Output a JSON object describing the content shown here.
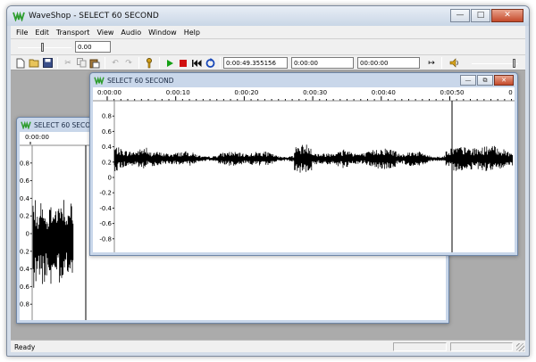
{
  "app": {
    "title": "WaveShop - SELECT 60 SECOND"
  },
  "menu": [
    "File",
    "Edit",
    "Transport",
    "View",
    "Audio",
    "Window",
    "Help"
  ],
  "toolbar": {
    "gain_value": "0.00",
    "position_time": "0:00:49.355156",
    "selection_start": "0:00:00",
    "selection_length": "00:00:00"
  },
  "back_window": {
    "title": "SELECT 60 SECOND",
    "ruler_start": "0:00:00",
    "amp_labels": [
      "0.8",
      "0.6",
      "0.4",
      "0.2",
      "0",
      "-0.2",
      "-0.4",
      "-0.6",
      "-0.8"
    ]
  },
  "front_window": {
    "title": "SELECT 60 SECOND",
    "ruler_labels": [
      "0:00:00",
      "0:00:10",
      "0:00:20",
      "0:00:30",
      "0:00:40",
      "0:00:50",
      "0"
    ],
    "amp_labels": [
      "0.8",
      "0.6",
      "0.4",
      "0.2",
      "0",
      "-0.2",
      "-0.4",
      "-0.6",
      "-0.8"
    ]
  },
  "status": {
    "text": "Ready"
  },
  "colors": {
    "waveform": "#000000",
    "title_icon": "#2e9d2e",
    "play": "#14a014",
    "stop": "#d01010",
    "loop": "#1747b8"
  },
  "icons": [
    "app-logo-icon",
    "new-icon",
    "open-icon",
    "save-icon",
    "cut-icon",
    "copy-icon",
    "paste-icon",
    "undo-icon",
    "redo-icon",
    "key-icon",
    "play-icon",
    "stop-icon",
    "rewind-icon",
    "loop-icon",
    "fit-icon",
    "speaker-icon"
  ]
}
